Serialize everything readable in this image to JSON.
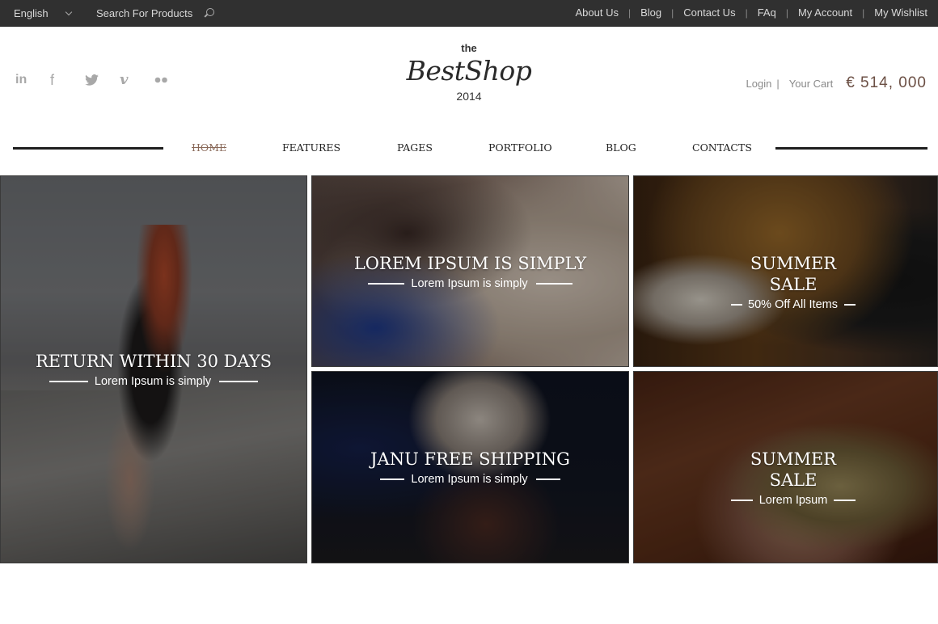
{
  "topbar": {
    "language": "English",
    "search_placeholder": "Search For Products",
    "links": [
      "About Us",
      "Blog",
      "Contact Us",
      "FAq",
      "My Account",
      "My Wishlist"
    ]
  },
  "social": [
    "linkedin-icon",
    "facebook-icon",
    "twitter-icon",
    "vimeo-icon",
    "flickr-icon"
  ],
  "logo": {
    "the": "the",
    "name": "BestShop",
    "year": "2014"
  },
  "account": {
    "login": "Login",
    "separator": "|",
    "cart": "Your Cart",
    "cart_total": "€ 514, 000"
  },
  "nav": {
    "items": [
      "HOME",
      "FEATURES",
      "PAGES",
      "PORTFOLIO",
      "BLOG",
      "CONTACTS"
    ],
    "active": "HOME"
  },
  "promos": [
    {
      "title": "RETURN WITHIN 30 DAYS",
      "subtitle": "Lorem Ipsum is simply"
    },
    {
      "title": "LOREM IPSUM IS SIMPLY",
      "subtitle": "Lorem Ipsum is simply"
    },
    {
      "title": "SUMMER SALE",
      "subtitle": "50% Off All Items"
    },
    {
      "title": "JANU FREE SHIPPING",
      "subtitle": "Lorem Ipsum is simply"
    },
    {
      "title": "SUMMER SALE",
      "subtitle": "Lorem Ipsum"
    }
  ],
  "colors": {
    "topbar_bg": "#303030",
    "price": "#6b4f44",
    "nav_active": "#8a6a5a"
  }
}
